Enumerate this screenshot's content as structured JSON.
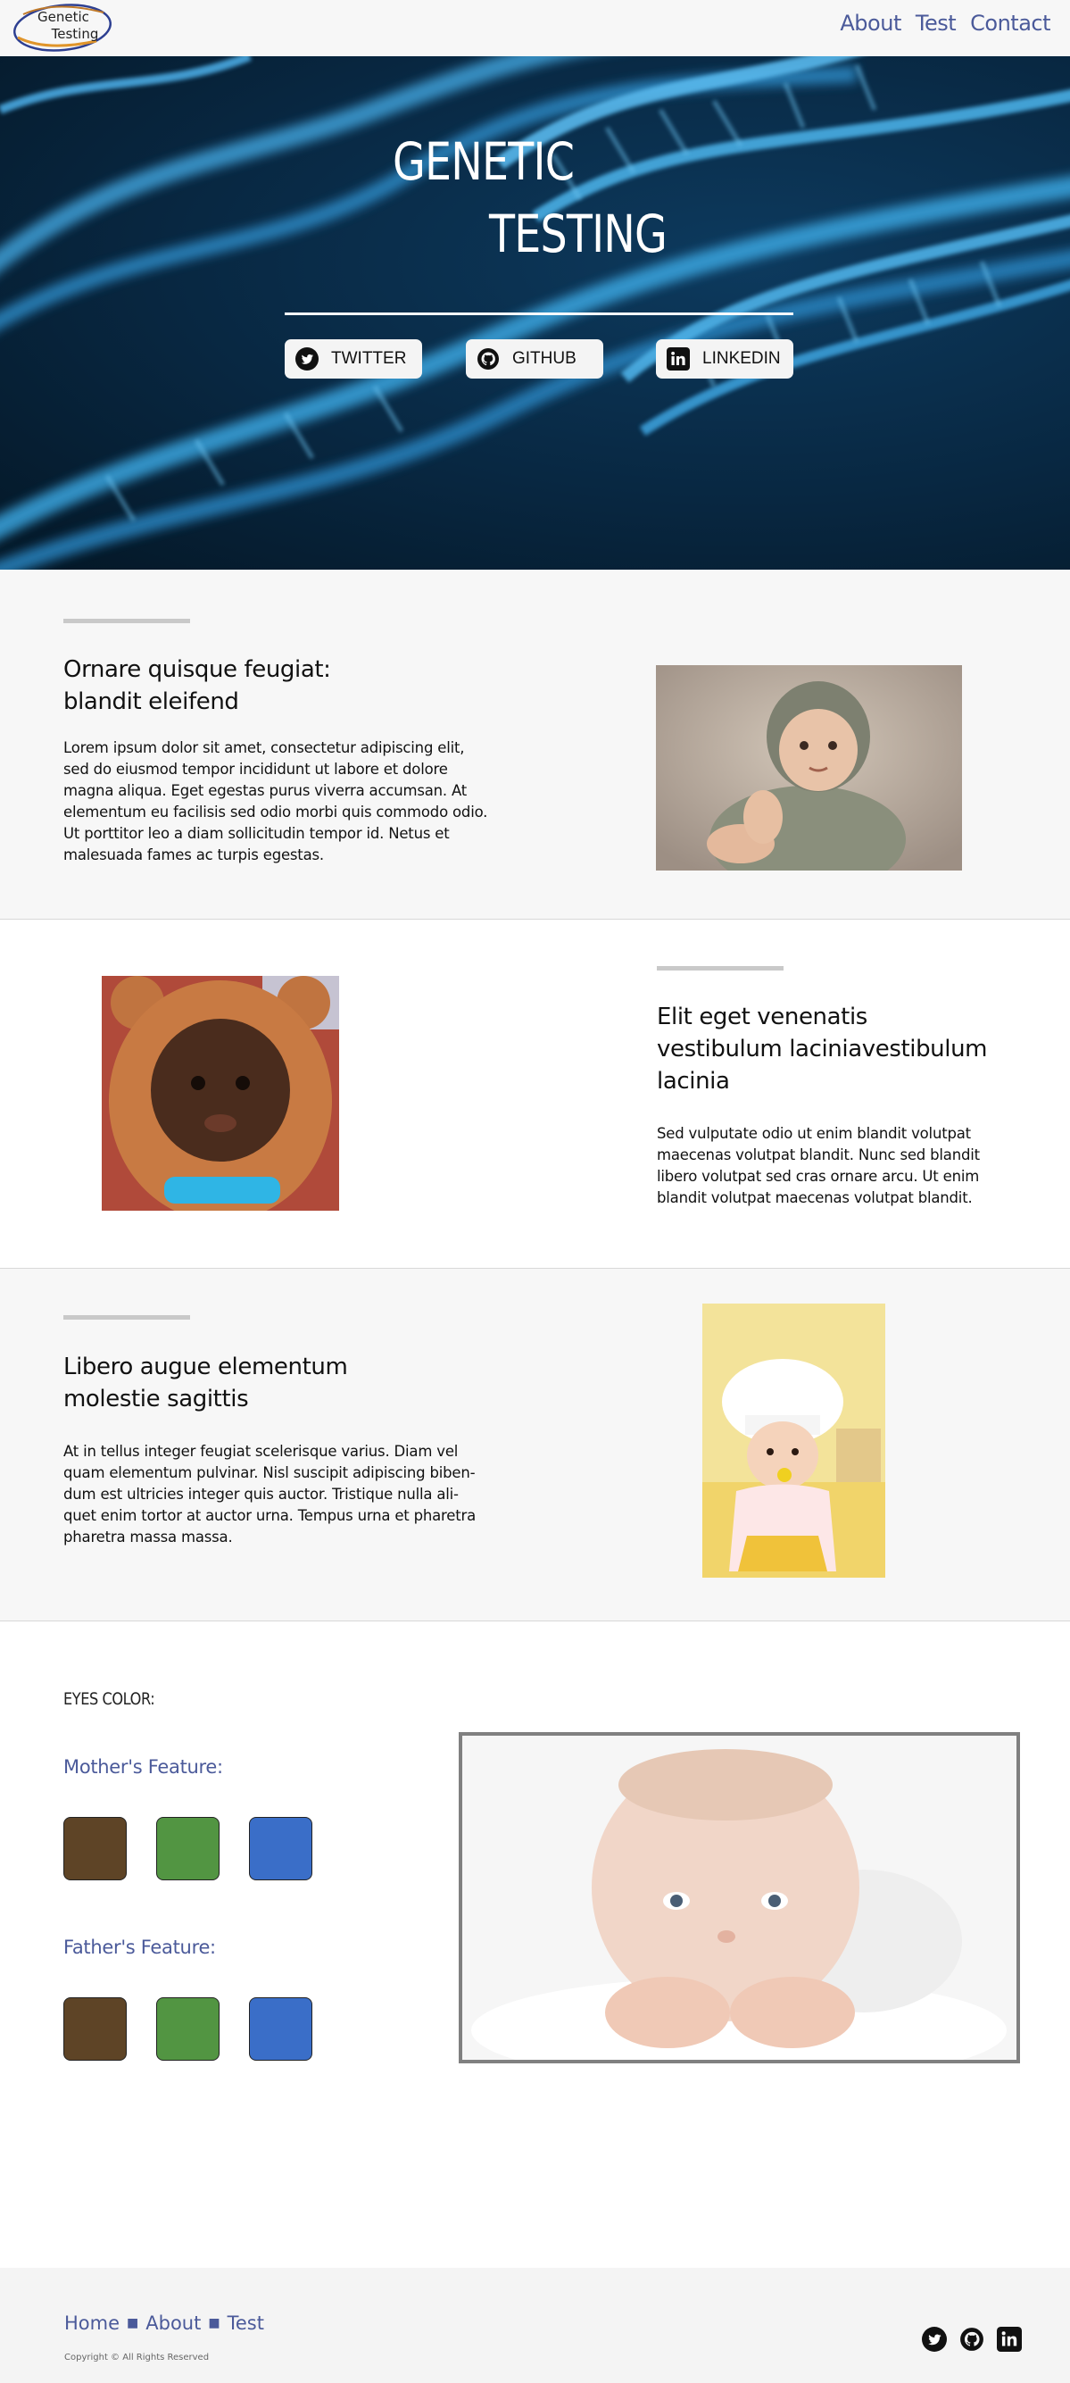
{
  "header": {
    "logo_line1": "Genetic",
    "logo_line2": "Testing",
    "nav": [
      "About",
      "Test",
      "Contact"
    ]
  },
  "hero": {
    "title_line1": "GENETIC",
    "title_line2": "TESTING",
    "buttons": [
      {
        "label": "TWITTER",
        "icon": "twitter-icon"
      },
      {
        "label": "GITHUB",
        "icon": "github-icon"
      },
      {
        "label": "LINKEDIN",
        "icon": "linkedin-icon"
      }
    ]
  },
  "sections": [
    {
      "title_line1": "Ornare quisque feugiat:",
      "title_line2": "blandit eleifend",
      "body": [
        "Lorem ipsum dolor sit amet, consectetur adipiscing elit,",
        "sed do eiusmod tempor incididunt ut labore et dolore",
        "magna aliqua. Eget egestas purus viverra accumsan. At",
        "elementum eu facilisis sed odio morbi quis commodo odio.",
        "Ut porttitor leo a diam sollicitudin tempor id. Netus et",
        "malesuada fames ac turpis egestas."
      ],
      "image": "baby-in-knit-hood-photo"
    },
    {
      "title_line1": "Elit eget venenatis",
      "title_line2": "vestibulum laciniavestibulum",
      "title_line3": "lacinia",
      "body": [
        "Sed vulputate odio ut enim blandit volutpat",
        "maecenas volutpat blandit. Nunc sed blandit",
        "libero volutpat sed cras ornare arcu. Ut enim",
        "blandit volutpat maecenas volutpat blandit."
      ],
      "image": "baby-in-bear-costume-photo"
    },
    {
      "title_line1": "Libero augue elementum",
      "title_line2": "molestie sagittis",
      "body": [
        "At in tellus integer feugiat scelerisque varius. Diam vel",
        "quam elementum pulvinar. Nisl suscipit adipiscing biben-",
        "dum est ultricies integer quis auctor. Tristique nulla ali-",
        "quet enim tortor at auctor urna. Tempus urna et pharetra",
        "pharetra massa massa."
      ],
      "image": "baby-in-chef-hat-photo"
    }
  ],
  "eyes": {
    "label": "EYES COLOR:",
    "mother_label": "Mother's Feature:",
    "father_label": "Father's Feature:",
    "colors": [
      "#5e4426",
      "#529542",
      "#3a6ec8"
    ],
    "image": "smiling-baby-photo"
  },
  "footer": {
    "links": [
      "Home",
      "About",
      "Test"
    ],
    "copyright": "Copyright © All Rights Reserved",
    "icons": [
      "twitter-icon",
      "github-icon",
      "linkedin-icon"
    ]
  }
}
